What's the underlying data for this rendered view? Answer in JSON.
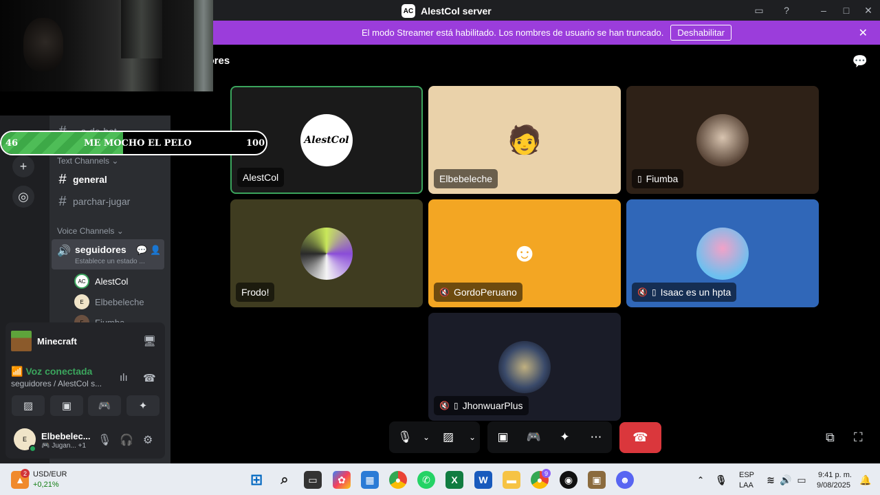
{
  "window": {
    "title": "AlestCol server"
  },
  "banner": {
    "message": "El modo Streamer está habilitado. Los nombres de usuario se han truncado.",
    "button": "Deshabilitar"
  },
  "goal": {
    "left_value": "46",
    "title": "ME MOCHO EL PELO",
    "right_value": "100",
    "progress": 0.46
  },
  "sidebar": {
    "partial_channel": "...a-de-bot",
    "text_header": "Text Channels",
    "text_channels": [
      "general",
      "parchar-jugar"
    ],
    "voice_header": "Voice Channels",
    "voice_channel": {
      "name": "seguidores",
      "status": "Establece un estado ..."
    },
    "members": [
      "AlestCol",
      "Elbebeleche",
      "Fiumba"
    ]
  },
  "voice_panel": {
    "game": "Minecraft",
    "connected": "Voz conectada",
    "location": "seguidores / AlestCol s..."
  },
  "user_panel": {
    "name": "Elbebelec...",
    "status": "Jugan...",
    "extra": "+1"
  },
  "stage": {
    "title": "uidores",
    "tiles": [
      {
        "name": "AlestCol",
        "avatar_text": "AlestCol",
        "muted": false,
        "mobile": false,
        "speaking": true
      },
      {
        "name": "Elbebeleche",
        "muted": false,
        "mobile": false
      },
      {
        "name": "Fiumba",
        "muted": false,
        "mobile": true
      },
      {
        "name": "Frodo!",
        "muted": false,
        "mobile": false
      },
      {
        "name": "GordoPeruano",
        "muted": true,
        "mobile": false
      },
      {
        "name": "Isaac es un hpta",
        "muted": true,
        "mobile": true
      },
      {
        "name": "JhonwuarPlus",
        "muted": true,
        "mobile": true
      }
    ]
  },
  "taskbar": {
    "widget_badge": "2",
    "ticker": "USD/EUR",
    "change": "+0,21%",
    "lang1": "ESP",
    "lang2": "LAA",
    "time": "9:41 p. m.",
    "date": "9/08/2025",
    "chrome_badge": "9"
  },
  "colors": {
    "banner": "#9b3ddb",
    "end_call": "#da373c",
    "connected": "#3ba55d",
    "speaking_border": "#3ba55d"
  }
}
